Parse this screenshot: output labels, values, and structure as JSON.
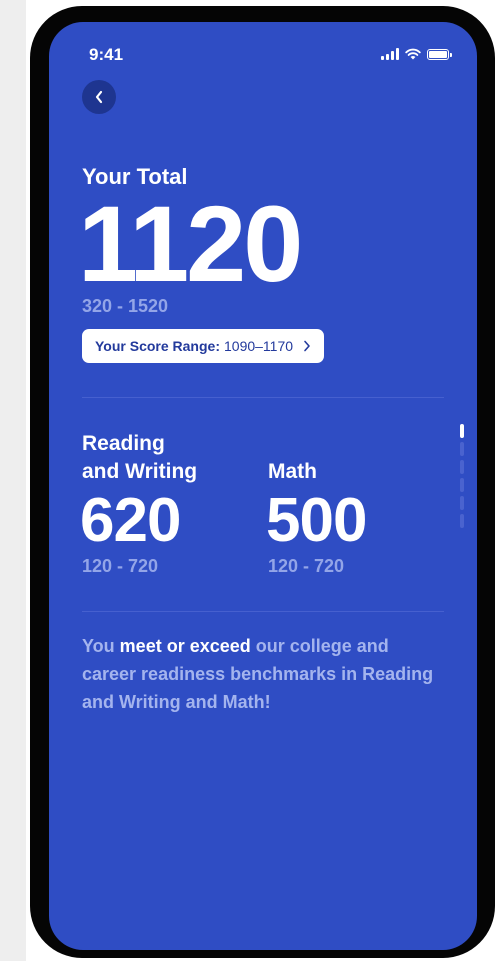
{
  "status_bar": {
    "time": "9:41"
  },
  "total": {
    "label": "Your Total",
    "value": "1120",
    "range": "320 - 1520",
    "score_range_label": "Your Score Range:",
    "score_range_value": "1090–1170"
  },
  "sections": [
    {
      "label_line1": "Reading",
      "label_line2": "and Writing",
      "value": "620",
      "range": "120 - 720"
    },
    {
      "label_line1": "",
      "label_line2": "Math",
      "value": "500",
      "range": "120 - 720"
    }
  ],
  "message": {
    "part1": "You ",
    "bold": "meet or exceed",
    "part2": " our college and career readiness benchmarks in Reading and Writing and Math!"
  },
  "colors": {
    "screen_bg": "#2f4dc4",
    "muted_text": "#93a5e8",
    "back_button_bg": "#1e3590"
  }
}
